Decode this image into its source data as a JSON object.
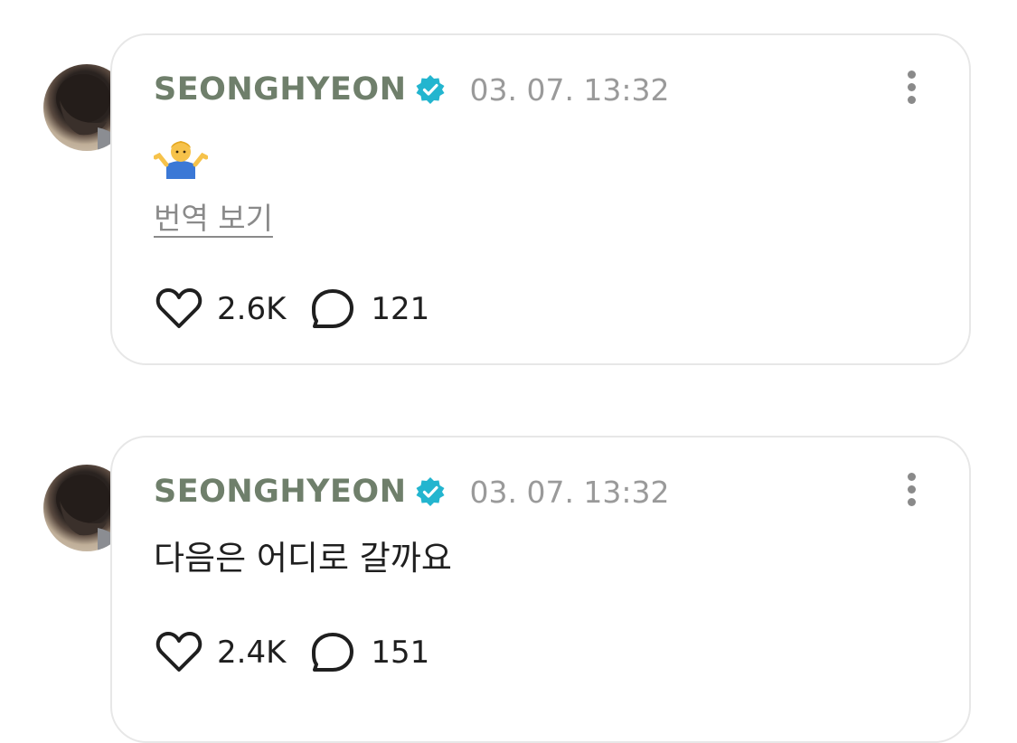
{
  "colors": {
    "author": "#6f7f6b",
    "verified": "#23b5cf",
    "muted": "#9a9a9a"
  },
  "posts": [
    {
      "author": "SEONGHYEON",
      "timestamp": "03. 07. 13:32",
      "body_emoji": "person-shrugging-emoji",
      "translate_label": "번역 보기",
      "likes": "2.6K",
      "comments": "121"
    },
    {
      "author": "SEONGHYEON",
      "timestamp": "03. 07. 13:32",
      "body_text": "다음은 어디로 갈까요",
      "likes": "2.4K",
      "comments": "151"
    }
  ]
}
